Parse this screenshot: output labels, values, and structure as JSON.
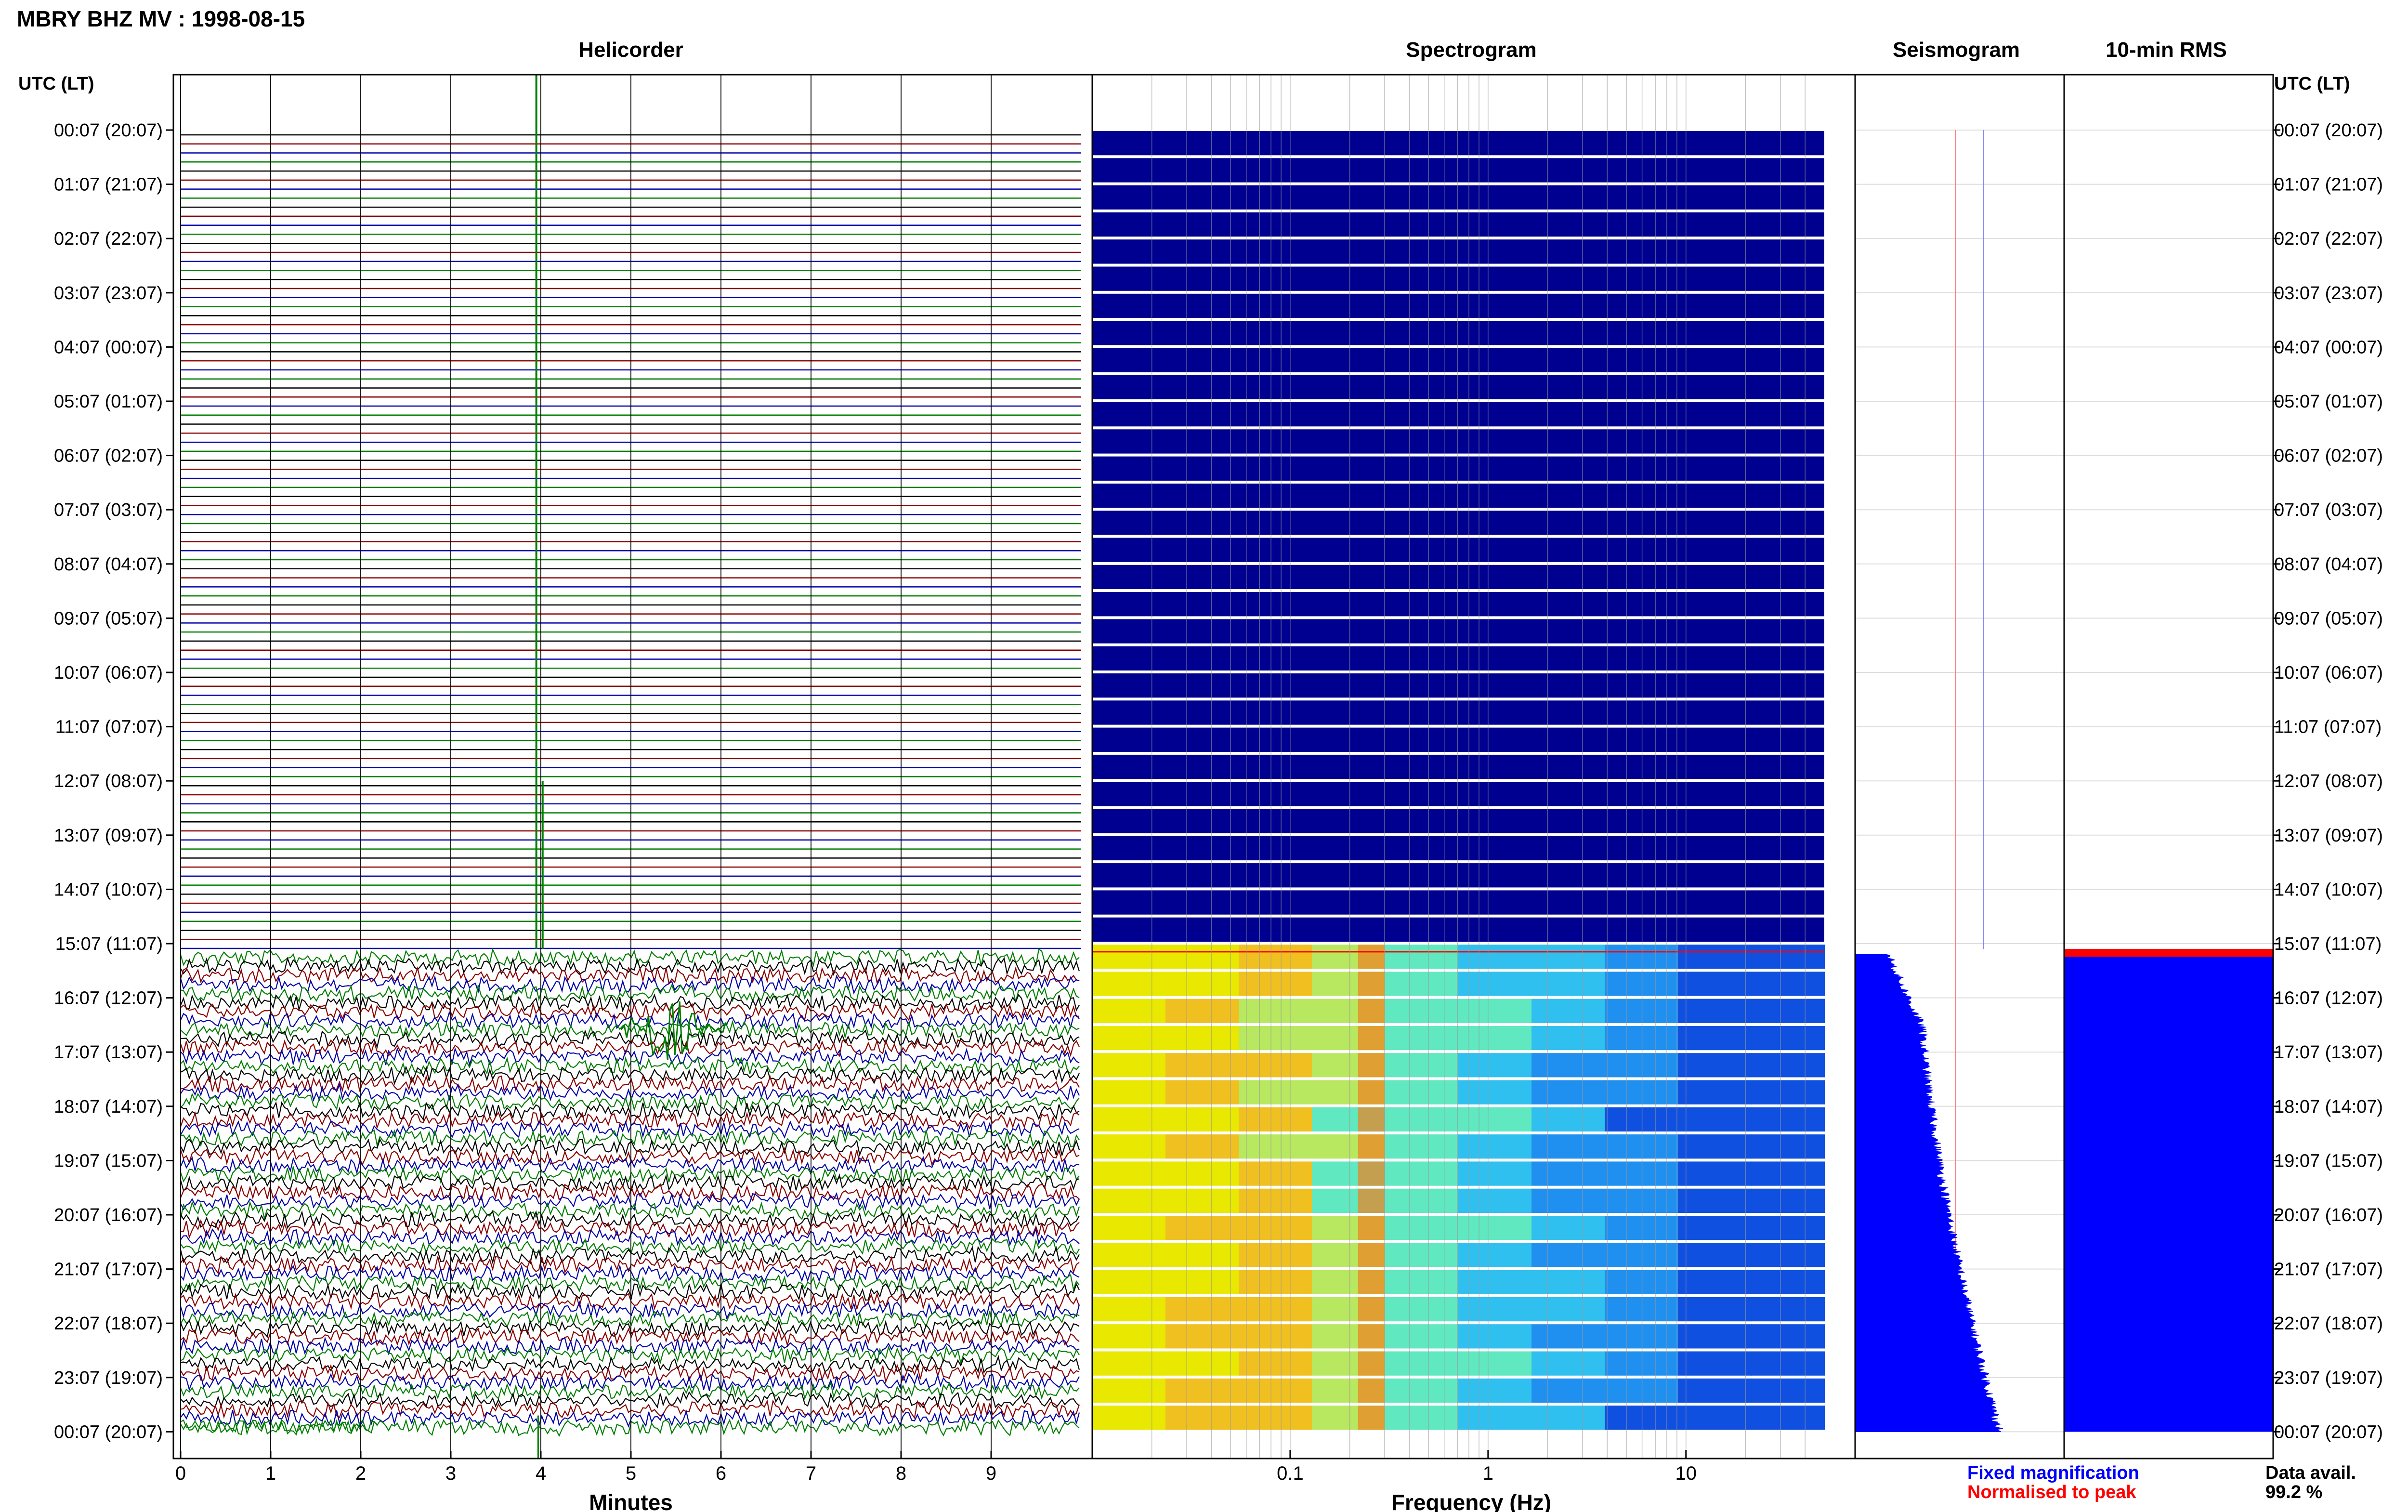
{
  "page_title": "MBRY BHZ MV : 1998-08-15",
  "panels": {
    "helicorder": "Helicorder",
    "spectrogram": "Spectrogram",
    "seismogram": "Seismogram",
    "rms": "10-min RMS"
  },
  "time_axis_title": "UTC (LT)",
  "footer": {
    "fixed_magnification": "Fixed magnification",
    "normalised_to_peak": "Normalised to peak",
    "data_avail_label": "Data avail.",
    "data_avail_value": "99.2 %"
  },
  "colors": {
    "trace_black": "#000000",
    "trace_red": "#8b0000",
    "trace_blue": "#0000aa",
    "trace_green": "#007f00",
    "spectrogram_bg": "#000090",
    "rms_fill": "#0000ff",
    "rms_peak": "#ff0000",
    "legend_fixed": "#0000ff",
    "legend_normalised": "#ff0000"
  },
  "chart_data": {
    "type": "heatmap",
    "time_labels": [
      "00:07 (20:07)",
      "01:07 (21:07)",
      "02:07 (22:07)",
      "03:07 (23:07)",
      "04:07 (00:07)",
      "05:07 (01:07)",
      "06:07 (02:07)",
      "07:07 (03:07)",
      "08:07 (04:07)",
      "09:07 (05:07)",
      "10:07 (06:07)",
      "11:07 (07:07)",
      "12:07 (08:07)",
      "13:07 (09:07)",
      "14:07 (10:07)",
      "15:07 (11:07)",
      "16:07 (12:07)",
      "17:07 (13:07)",
      "18:07 (14:07)",
      "19:07 (15:07)",
      "20:07 (16:07)",
      "21:07 (17:07)",
      "22:07 (18:07)",
      "23:07 (19:07)",
      "00:07 (20:07)"
    ],
    "helicorder": {
      "xlabel": "Minutes",
      "xlim": [
        0,
        10
      ],
      "xticks": [
        0,
        1,
        2,
        3,
        4,
        5,
        6,
        7,
        8,
        9
      ],
      "rows_per_hour": 6,
      "data_start_hour": 15.15,
      "data_end_hour": 23.95
    },
    "spectrogram": {
      "xlabel": "Frequency (Hz)",
      "xscale": "log",
      "xlim": [
        0.01,
        50
      ],
      "xticks": [
        0.1,
        1,
        10
      ],
      "tick_labels": [
        "0.1",
        "1",
        "10"
      ]
    },
    "seismogram": {
      "signal_start_hour": 15.2,
      "signal_end_hour": 24.0
    },
    "rms": {
      "signal_start_hour": 15.1,
      "signal_end_hour": 24.0
    }
  }
}
